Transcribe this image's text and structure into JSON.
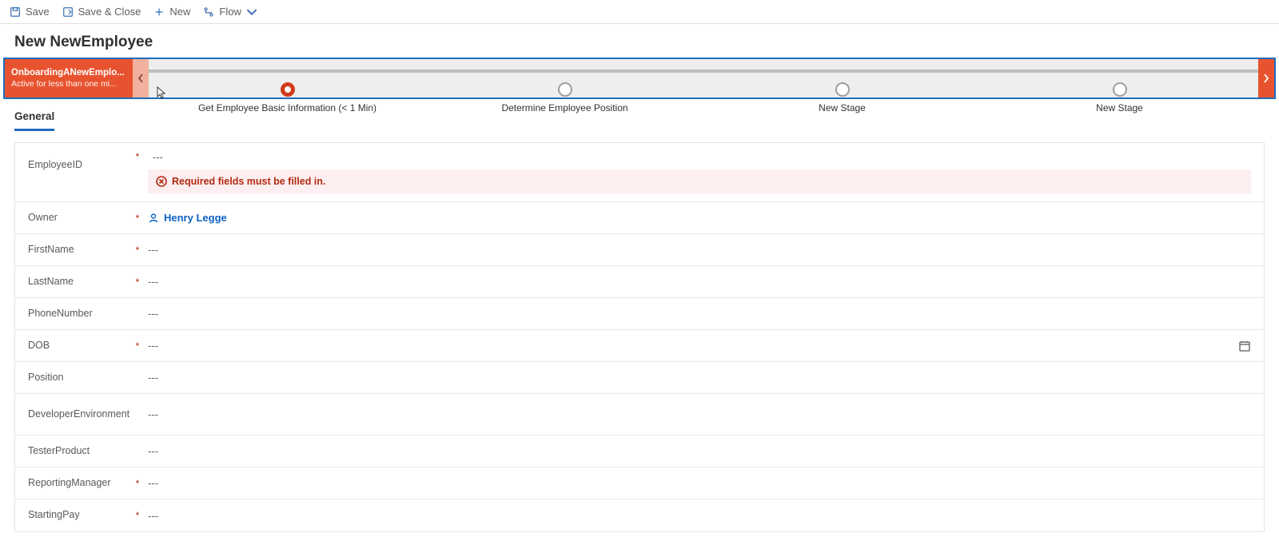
{
  "commandbar": {
    "save": "Save",
    "saveclose": "Save & Close",
    "new": "New",
    "flow": "Flow"
  },
  "header": {
    "title": "New NewEmployee"
  },
  "bpf": {
    "process_name": "OnboardingANewEmplo...",
    "status": "Active for less than one mi...",
    "stages": [
      {
        "label": "Get Employee Basic Information  (< 1 Min)",
        "active": true
      },
      {
        "label": "Determine Employee Position",
        "active": false
      },
      {
        "label": "New Stage",
        "active": false
      },
      {
        "label": "New Stage",
        "active": false
      }
    ]
  },
  "tabs": {
    "general": "General"
  },
  "form": {
    "dash": "---",
    "error": "Required fields must be filled in.",
    "owner_name": "Henry Legge",
    "labels": {
      "employeeid": "EmployeeID",
      "owner": "Owner",
      "firstname": "FirstName",
      "lastname": "LastName",
      "phonenumber": "PhoneNumber",
      "dob": "DOB",
      "position": "Position",
      "devenv": "DeveloperEnvironment",
      "testerproduct": "TesterProduct",
      "reportingmanager": "ReportingManager",
      "startingpay": "StartingPay"
    }
  }
}
